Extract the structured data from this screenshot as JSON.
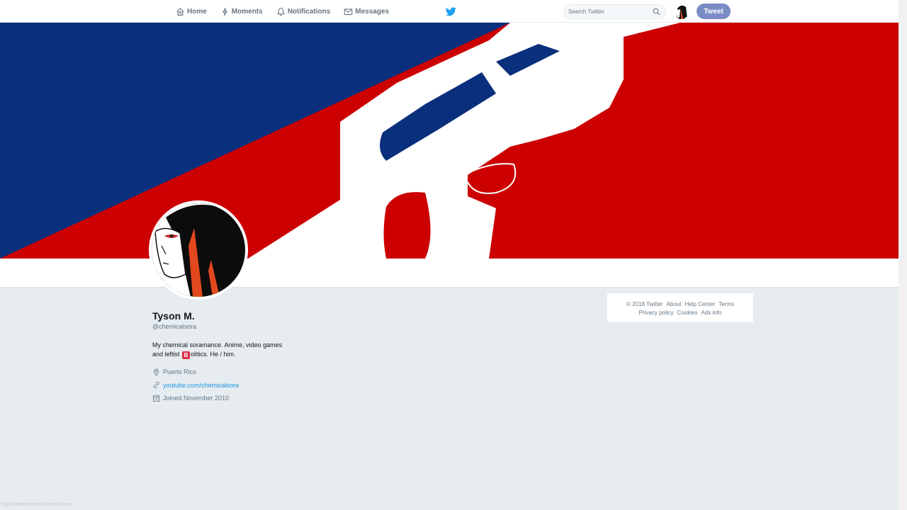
{
  "nav": {
    "items": [
      {
        "label": "Home",
        "icon": "home-icon"
      },
      {
        "label": "Moments",
        "icon": "lightning-icon"
      },
      {
        "label": "Notifications",
        "icon": "bell-icon"
      },
      {
        "label": "Messages",
        "icon": "envelope-icon"
      }
    ],
    "logo_icon": "twitter-bird-icon",
    "search_placeholder": "Search Twitter",
    "tweet_button": "Tweet"
  },
  "profile": {
    "name": "Tyson M.",
    "handle": "@chemicalsora",
    "bio_part1": "My chemical soramance. Anime, video games and leftist ",
    "bio_emoji": "B",
    "bio_part2": "olitics. He / him.",
    "location": "Puerto Rico",
    "website": "youtube.com/chemicalsora",
    "joined": "Joined November 2010"
  },
  "footer": {
    "copyright": "© 2018 Twitter",
    "links_row1": [
      "About",
      "Help Center",
      "Terms"
    ],
    "links_row2": [
      "Privacy policy",
      "Cookies",
      "Ads info"
    ]
  },
  "status_url": "https://twitter.com/chemicalsora",
  "colors": {
    "accent": "#1da1f2",
    "banner_blue": "#0a2f7c",
    "banner_red": "#cc0000",
    "tweet_button": "#7a8bc6"
  }
}
